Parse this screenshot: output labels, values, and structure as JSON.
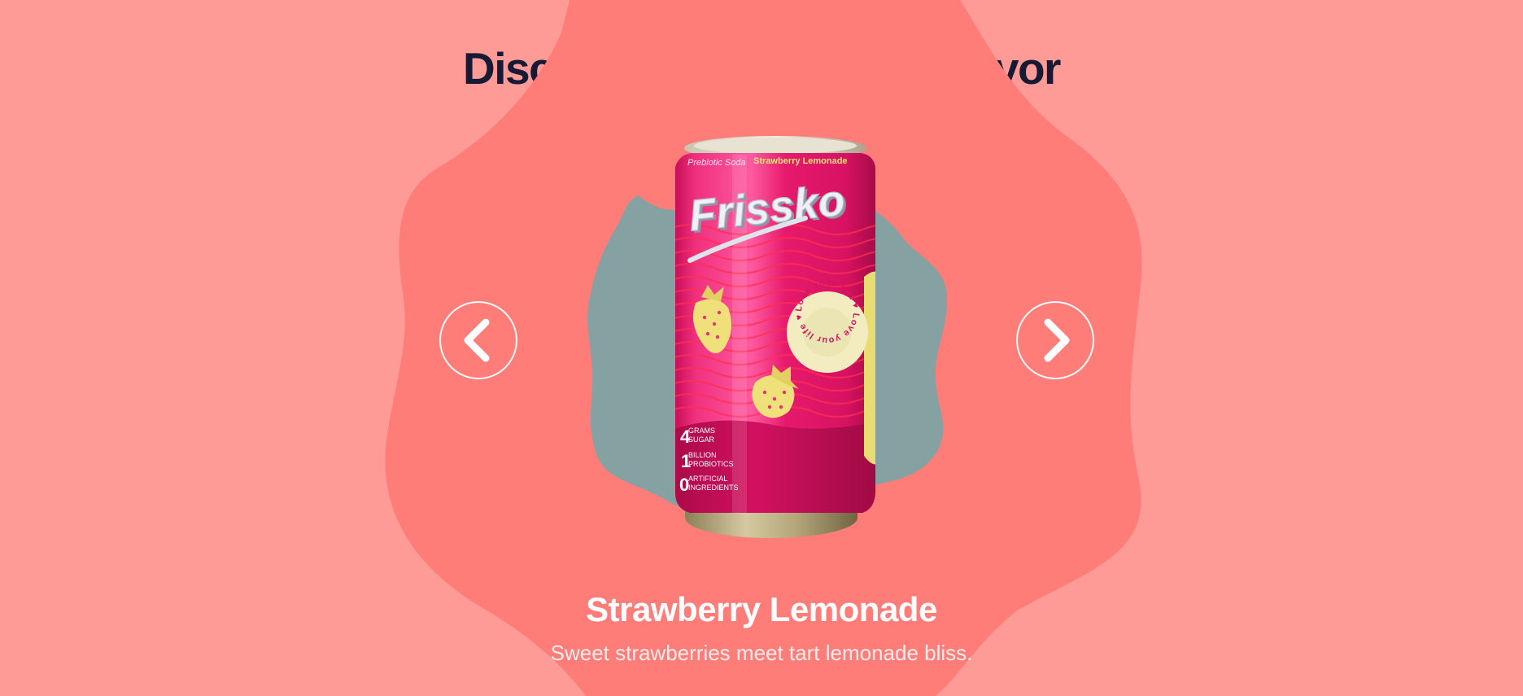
{
  "page": {
    "heading": "Discover Your Favorite Flavor",
    "colors": {
      "background": "#ff9b97",
      "blob_outer": "#ff7d79",
      "blob_inner": "#86a1a2",
      "heading": "#171a34",
      "can_pink": "#e7156b",
      "fruit_yellow": "#f1e27a"
    }
  },
  "carousel": {
    "prev_icon": "chevron-left-icon",
    "next_icon": "chevron-right-icon"
  },
  "product": {
    "brand": "Frissko",
    "rim_text_left": "Prebiotic Soda",
    "rim_text_right": "Strawberry Lemonade",
    "badge_text": "Love your gut ♥ Love your life ♥",
    "stats": [
      {
        "number": "4",
        "line1": "GRAMS",
        "line2": "SUGAR"
      },
      {
        "number": "1",
        "line1": "BILLION",
        "line2": "PROBIOTICS"
      },
      {
        "number": "0",
        "line1": "ARTIFICIAL",
        "line2": "INGREDIENTS"
      }
    ],
    "name": "Strawberry Lemonade",
    "description": "Sweet strawberries meet tart lemonade bliss."
  }
}
